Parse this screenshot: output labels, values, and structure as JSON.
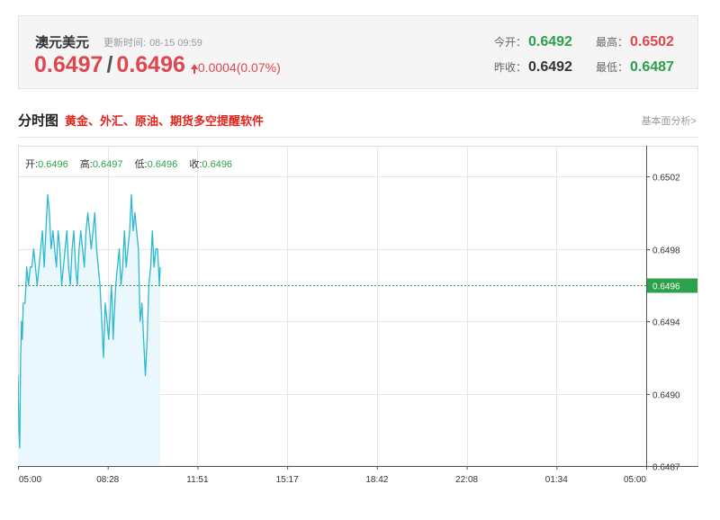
{
  "header": {
    "pair_name": "澳元美元",
    "update_label": "更新时间:",
    "update_time": "08-15 09:59",
    "bid": "0.6497",
    "ask": "0.6496",
    "change": "0.0004(0.07%)",
    "stats": {
      "open_label": "今开：",
      "open": "0.6492",
      "high_label": "最高：",
      "high": "0.6502",
      "prev_close_label": "昨收：",
      "prev_close": "0.6492",
      "low_label": "最低：",
      "low": "0.6487"
    }
  },
  "section": {
    "title": "分时图",
    "promo_link": "黄金、外汇、原油、期货多空提醒软件",
    "fundamental_link": "基本面分析>"
  },
  "ohlc": {
    "open_label": "开:",
    "open": "0.6496",
    "high_label": "高:",
    "high": "0.6497",
    "low_label": "低:",
    "low": "0.6496",
    "close_label": "收:",
    "close": "0.6496"
  },
  "colors": {
    "line": "#2bb8d0",
    "area": "#eaf7fc",
    "current_line": "#2ca04a",
    "grid": "#e6e6e6",
    "red": "#e0464e",
    "green": "#2ca04a"
  },
  "chart_data": {
    "type": "area",
    "x_ticks": [
      "05:00",
      "08:28",
      "11:51",
      "15:17",
      "18:42",
      "22:08",
      "01:34",
      "05:00"
    ],
    "y_ticks": [
      "0.6502",
      "0.6498",
      "0.6494",
      "0.6490",
      "0.6487"
    ],
    "y_tick_values": [
      0.6502,
      0.6498,
      0.6494,
      0.649,
      0.6486
    ],
    "ylim": [
      0.6486,
      0.65037
    ],
    "x_range": [
      0,
      1440
    ],
    "current_price": 0.6496,
    "current_label": "0.6496",
    "grid": true,
    "series": [
      {
        "x": [
          0,
          2,
          4,
          6,
          8,
          10,
          12,
          16,
          20,
          24,
          28,
          32,
          36,
          40,
          44,
          48,
          52,
          56,
          60,
          64,
          68,
          72,
          76,
          80,
          84,
          88,
          92,
          96,
          100,
          104,
          108,
          112,
          116,
          120,
          124,
          128,
          132,
          136,
          140,
          144,
          148,
          152,
          156,
          160,
          164,
          168,
          172,
          176,
          180,
          184,
          188,
          192,
          196,
          200,
          204,
          208,
          212,
          214,
          216,
          218,
          220,
          224,
          228,
          232,
          236,
          240,
          244,
          248,
          252,
          256,
          260,
          264,
          268,
          272,
          276,
          280,
          284,
          288,
          292,
          296,
          300,
          304,
          308,
          312,
          316,
          320,
          324,
          326
        ],
        "values": [
          0.6491,
          0.6488,
          0.6487,
          0.6492,
          0.6494,
          0.6493,
          0.6495,
          0.6495,
          0.6497,
          0.6496,
          0.6497,
          0.6497,
          0.6498,
          0.6497,
          0.6496,
          0.6497,
          0.6498,
          0.6499,
          0.6497,
          0.6499,
          0.6501,
          0.65,
          0.6498,
          0.6499,
          0.6498,
          0.6497,
          0.6499,
          0.6498,
          0.6496,
          0.6497,
          0.6498,
          0.6499,
          0.6497,
          0.6496,
          0.6498,
          0.6499,
          0.6497,
          0.6496,
          0.6498,
          0.6499,
          0.6498,
          0.6497,
          0.6499,
          0.65,
          0.6499,
          0.6498,
          0.6499,
          0.65,
          0.6498,
          0.6497,
          0.6496,
          0.6494,
          0.6492,
          0.6495,
          0.6494,
          0.6493,
          0.6495,
          0.6496,
          0.6495,
          0.6493,
          0.6494,
          0.6496,
          0.6497,
          0.6498,
          0.6496,
          0.6497,
          0.6499,
          0.6497,
          0.6498,
          0.6499,
          0.6501,
          0.6499,
          0.65,
          0.6499,
          0.6498,
          0.6494,
          0.6495,
          0.6493,
          0.6491,
          0.6493,
          0.6496,
          0.6497,
          0.6499,
          0.6497,
          0.6498,
          0.6498,
          0.6496,
          0.6497
        ]
      }
    ]
  }
}
